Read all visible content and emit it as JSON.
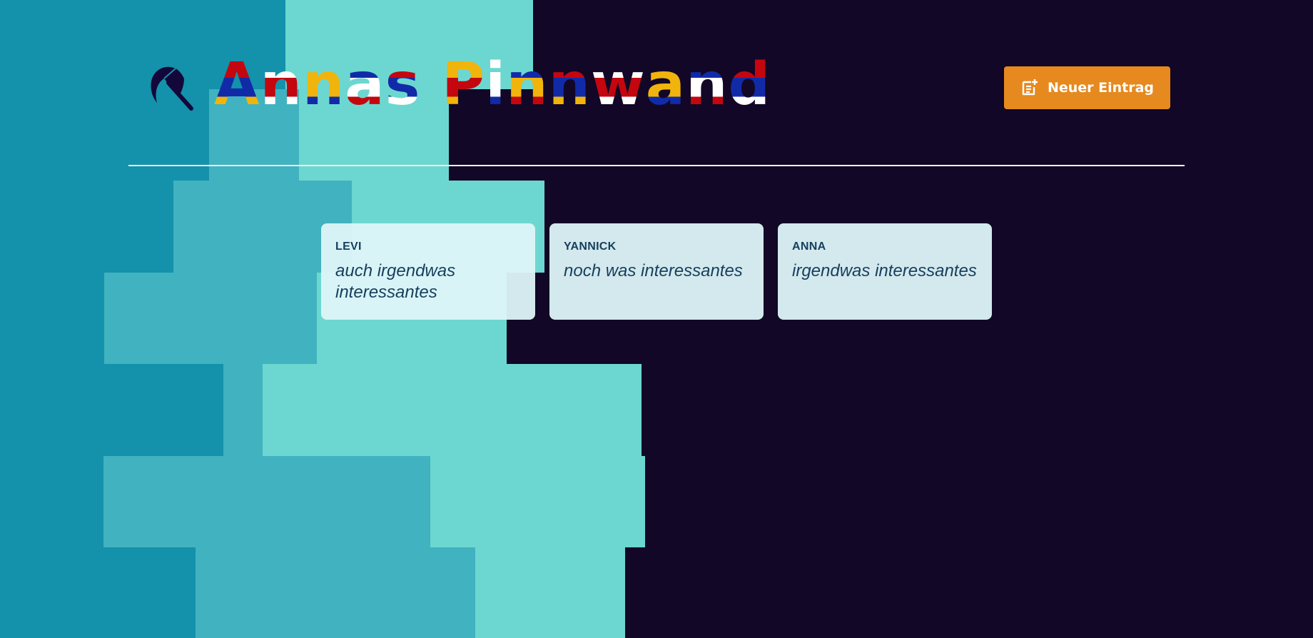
{
  "header": {
    "logo_icon": "umbrella-icon",
    "title": "Annas Pinnwand",
    "title_palette": [
      "#c4060f",
      "#ffffff",
      "#f0b40c",
      "#112ba8",
      "#c4060f",
      "#f0b40c",
      "#ffffff",
      "#112ba8"
    ],
    "new_entry": {
      "label": "Neuer Eintrag",
      "icon": "note-add-icon",
      "color": "#e6891f"
    }
  },
  "posts": [
    {
      "author": "LEVI",
      "text": "auch irgendwas interessantes"
    },
    {
      "author": "YANNICK",
      "text": "noch was interessantes"
    },
    {
      "author": "ANNA",
      "text": "irgendwas interessantes"
    }
  ],
  "colors": {
    "background": "#120726",
    "bg_teal_dark": "#1491ab",
    "bg_teal_mid": "#41b2bf",
    "bg_teal_light": "#6cd7d0",
    "card": "#def6f8",
    "card_text": "#173e5d"
  }
}
